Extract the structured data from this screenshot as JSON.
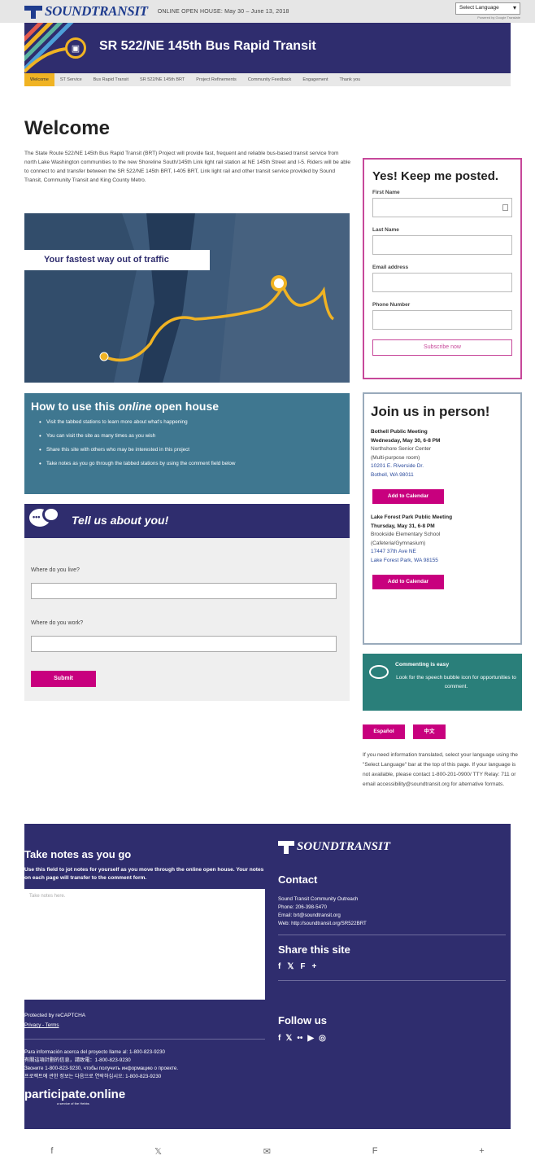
{
  "header": {
    "brand": "SOUNDTRANSIT",
    "open_house": "ONLINE OPEN HOUSE: May 30 – June 13, 2018",
    "language_select": "Select Language",
    "powered_by": "Powered by Google Translate"
  },
  "title": "SR 522/NE 145th Bus Rapid Transit",
  "nav": [
    "Welcome",
    "ST Service",
    "Bus Rapid Transit",
    "SR 522/NE 145th BRT",
    "Project Refinements",
    "Community Feedback",
    "Engagement",
    "Thank you"
  ],
  "welcome": {
    "heading": "Welcome",
    "intro": "The State Route 522/NE 145th Bus Rapid Transit (BRT) Project will provide fast, frequent and reliable bus-based transit service from north Lake Washington communities to the new Shoreline South/145th Link light rail station at NE 145th Street and I-5. Riders will be able to connect to and transfer between the SR 522/NE 145th BRT, I-405 BRT, Link light rail and other transit service provided by Sound Transit, Community Transit and King County Metro.",
    "map_banner": "Your fastest way out of traffic"
  },
  "subscribe": {
    "heading": "Yes! Keep me posted.",
    "first_name": "First Name",
    "last_name": "Last Name",
    "email": "Email address",
    "phone": "Phone Number",
    "button": "Subscribe now"
  },
  "howto": {
    "heading_plain": "How to use this",
    "heading_italic": "online",
    "heading_end": "open house",
    "items": [
      "Visit the tabbed stations to learn more about what's happening",
      "You can visit the site as many times as you wish",
      "Share this site with others who may be interested in this project",
      "Take notes as you go through the tabbed stations by using the comment field below"
    ]
  },
  "tellus": {
    "heading": "Tell us about you!",
    "q1": "Where do you live?",
    "q2": "Where do you work?",
    "submit": "Submit"
  },
  "join": {
    "heading": "Join us in person!",
    "m1_title": "Bothell Public Meeting",
    "m1_date": "Wednesday, May 30, 6-8 PM",
    "m1_place1": "Northshore Senior Center",
    "m1_place2": "(Multi-purpose room)",
    "m1_addr1": "10201 E. Riverside Dr.",
    "m1_addr2": "Bothell, WA 98011",
    "m2_title": "Lake Forest Park Public Meeting",
    "m2_date": "Thursday, May 31, 6-8 PM",
    "m2_place1": "Brookside Elementary School",
    "m2_place2": "(Cafeteria/Gymnasium)",
    "m2_addr1": "17447 37th Ave NE",
    "m2_addr2": "Lake Forest Park, WA 98155",
    "add_calendar": "Add to Calendar"
  },
  "commenting": {
    "title": "Commenting is easy",
    "text": "Look for the speech bubble icon for opportunities to comment."
  },
  "languages": {
    "espanol": "Español",
    "chinese": "中文",
    "note": "If you need information translated, select your language using the \"Select Language\" bar at the top of this page. If your language is not available, please contact 1-800-201-0900/ TTY Relay: 711 or email accessibility@soundtransit.org for alternative formats."
  },
  "footer": {
    "notes_heading": "Take notes as you go",
    "notes_sub": "Use this field to jot notes for yourself as you move through the online open house. Your notes on each page will transfer to the comment form.",
    "notes_placeholder": "Take notes here.",
    "recaptcha": "Protected by reCAPTCHA",
    "privacy": "Privacy - Terms",
    "multi1": "Para información acerca del proyecto llame al: 1-800-823-9230",
    "multi2": "有關這項計劃的信息，請致電：1-800-823-9230",
    "multi3": "Звоните 1-800-823-9230, чтобы получить информацию о проекте.",
    "multi4": "프로젝트에 관한 정보는 다음으로 연락하십시오: 1-800-823-9230",
    "participate": "participate.online",
    "participate_sub": "a service of the Hebbs",
    "brand": "SOUNDTRANSIT",
    "contact_heading": "Contact",
    "contact1": "Sound Transit Community Outreach",
    "contact_phone_label": "Phone:",
    "contact_phone": "206-398-5470",
    "contact_email_label": "Email:",
    "contact_email": "brt@soundtransit.org",
    "contact_web_label": "Web:",
    "contact_web": "http://soundtransit.org/SR522BRT",
    "share_heading": "Share this site",
    "follow_heading": "Follow us"
  },
  "icons": {
    "facebook": "f",
    "twitter": "𝕏",
    "flipboard": "F",
    "plus": "+",
    "flickr": "••",
    "youtube": "▶",
    "instagram": "◎"
  },
  "colors": {
    "navy": "#2f2d6e",
    "magenta": "#c8007e",
    "teal": "#3f7790",
    "green": "#2a7f7a",
    "yellow": "#f0b323"
  }
}
